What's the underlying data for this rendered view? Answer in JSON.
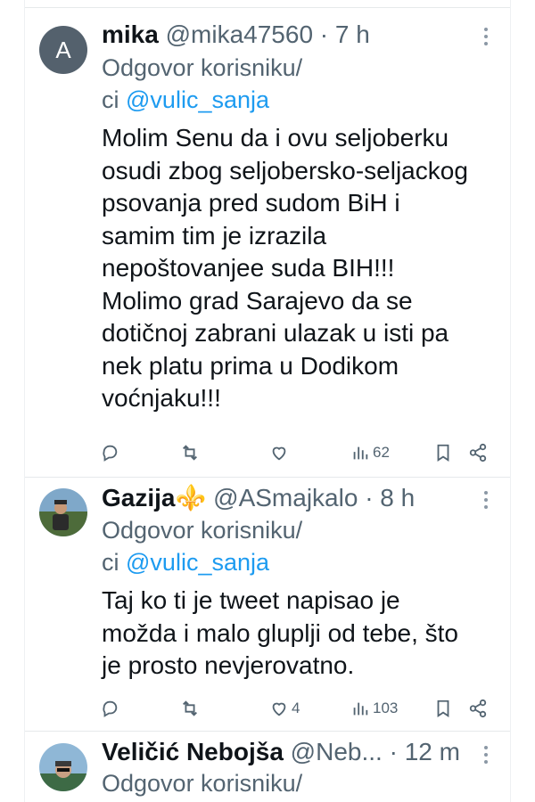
{
  "tweets": [
    {
      "avatar_letter": "A",
      "name": "mika",
      "handle": "@mika47560",
      "time": "7 h",
      "reply_prefix_line1": "Odgovor korisniku/",
      "reply_prefix_line2": "ci",
      "reply_mention": "@vulic_sanja",
      "text_lines": [
        "Molim Senu da i ovu seljoberku",
        "osudi zbog seljobersko-seljackog",
        "psovanja pred sudom BiH i",
        "samim tim je izrazila",
        "nepoštovanjee suda BIH!!!",
        "Molimo grad Sarajevo da se",
        "dotičnoj zabrani ulazak u isti pa",
        "nek platu prima u Dodikom",
        "voćnjaku!!!"
      ],
      "likes": "",
      "views": "62"
    },
    {
      "name": "Gazija⚜️",
      "handle": "@ASmajkalo",
      "time": "8 h",
      "reply_prefix_line1": "Odgovor korisniku/",
      "reply_prefix_line2": "ci",
      "reply_mention": "@vulic_sanja",
      "text_lines": [
        "Taj ko ti je tweet napisao je",
        "možda i malo gluplji od tebe, što",
        "je prosto nevjerovatno."
      ],
      "likes": "4",
      "views": "103"
    },
    {
      "name": "Veličić Nebojša",
      "handle": "@Neb...",
      "time": "12 m",
      "reply_prefix_line1": "Odgovor korisniku/"
    }
  ],
  "dot_separator": "·",
  "icons": [
    "reply-icon",
    "retweet-icon",
    "like-icon",
    "views-icon",
    "bookmark-icon",
    "share-icon",
    "more-icon"
  ],
  "colors": {
    "mention": "#1d9bf0",
    "secondary_text": "#536471",
    "primary_text": "#0f1419"
  }
}
